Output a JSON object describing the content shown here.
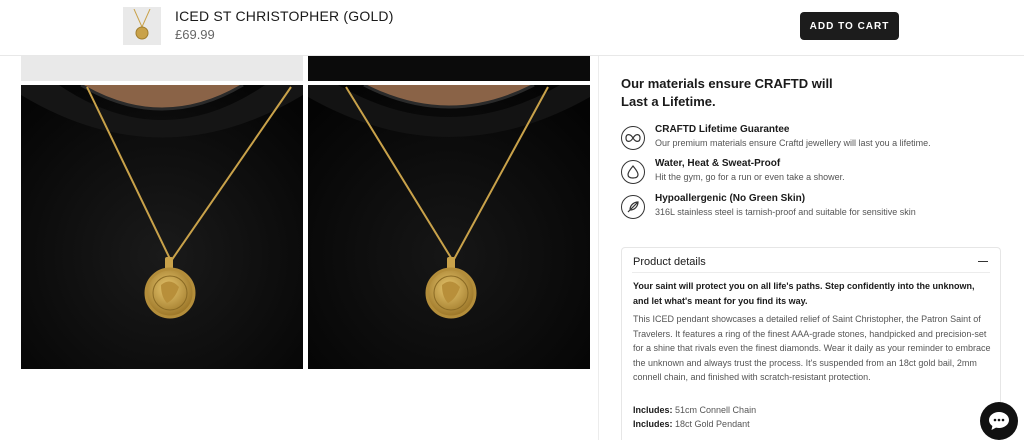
{
  "sticky_bar": {
    "product_name": "ICED ST CHRISTOPHER (GOLD)",
    "price": "£69.99",
    "add_to_cart_label": "ADD TO CART"
  },
  "materials": {
    "heading_line1": "Our materials ensure CRAFTD will",
    "heading_line2": "Last a Lifetime.",
    "features": [
      {
        "icon": "lifetime-guarantee-icon",
        "title": "CRAFTD Lifetime Guarantee",
        "description": "Our premium materials ensure Craftd jewellery will last you a lifetime."
      },
      {
        "icon": "water-drop-icon",
        "title": "Water, Heat & Sweat-Proof",
        "description": "Hit the gym, go for a run or even take a shower."
      },
      {
        "icon": "feather-icon",
        "title": "Hypoallergenic (No Green Skin)",
        "description": "316L stainless steel is tarnish-proof and suitable for sensitive skin"
      }
    ]
  },
  "product_details": {
    "heading": "Product details",
    "lead": "Your saint will protect you on all life's paths. Step confidently into the unknown, and let what's meant for you find its way.",
    "body": "This ICED pendant showcases a detailed relief of Saint Christopher, the Patron Saint of Travelers. It features a ring of the finest AAA-grade stones, handpicked and precision-set for a shine that rivals even the finest diamonds. Wear it daily as your reminder to embrace the unknown and always trust the process. It's suspended from an 18ct gold bail, 2mm connell chain, and finished with scratch-resistant protection.",
    "includes": [
      {
        "label": "Includes:",
        "value": "51cm Connell Chain"
      },
      {
        "label": "Includes:",
        "value": "18ct Gold Pendant"
      }
    ]
  },
  "colors": {
    "button_dark": "#1c1c1c",
    "gold": "#c9a24a",
    "photo_bg": "#000000"
  }
}
